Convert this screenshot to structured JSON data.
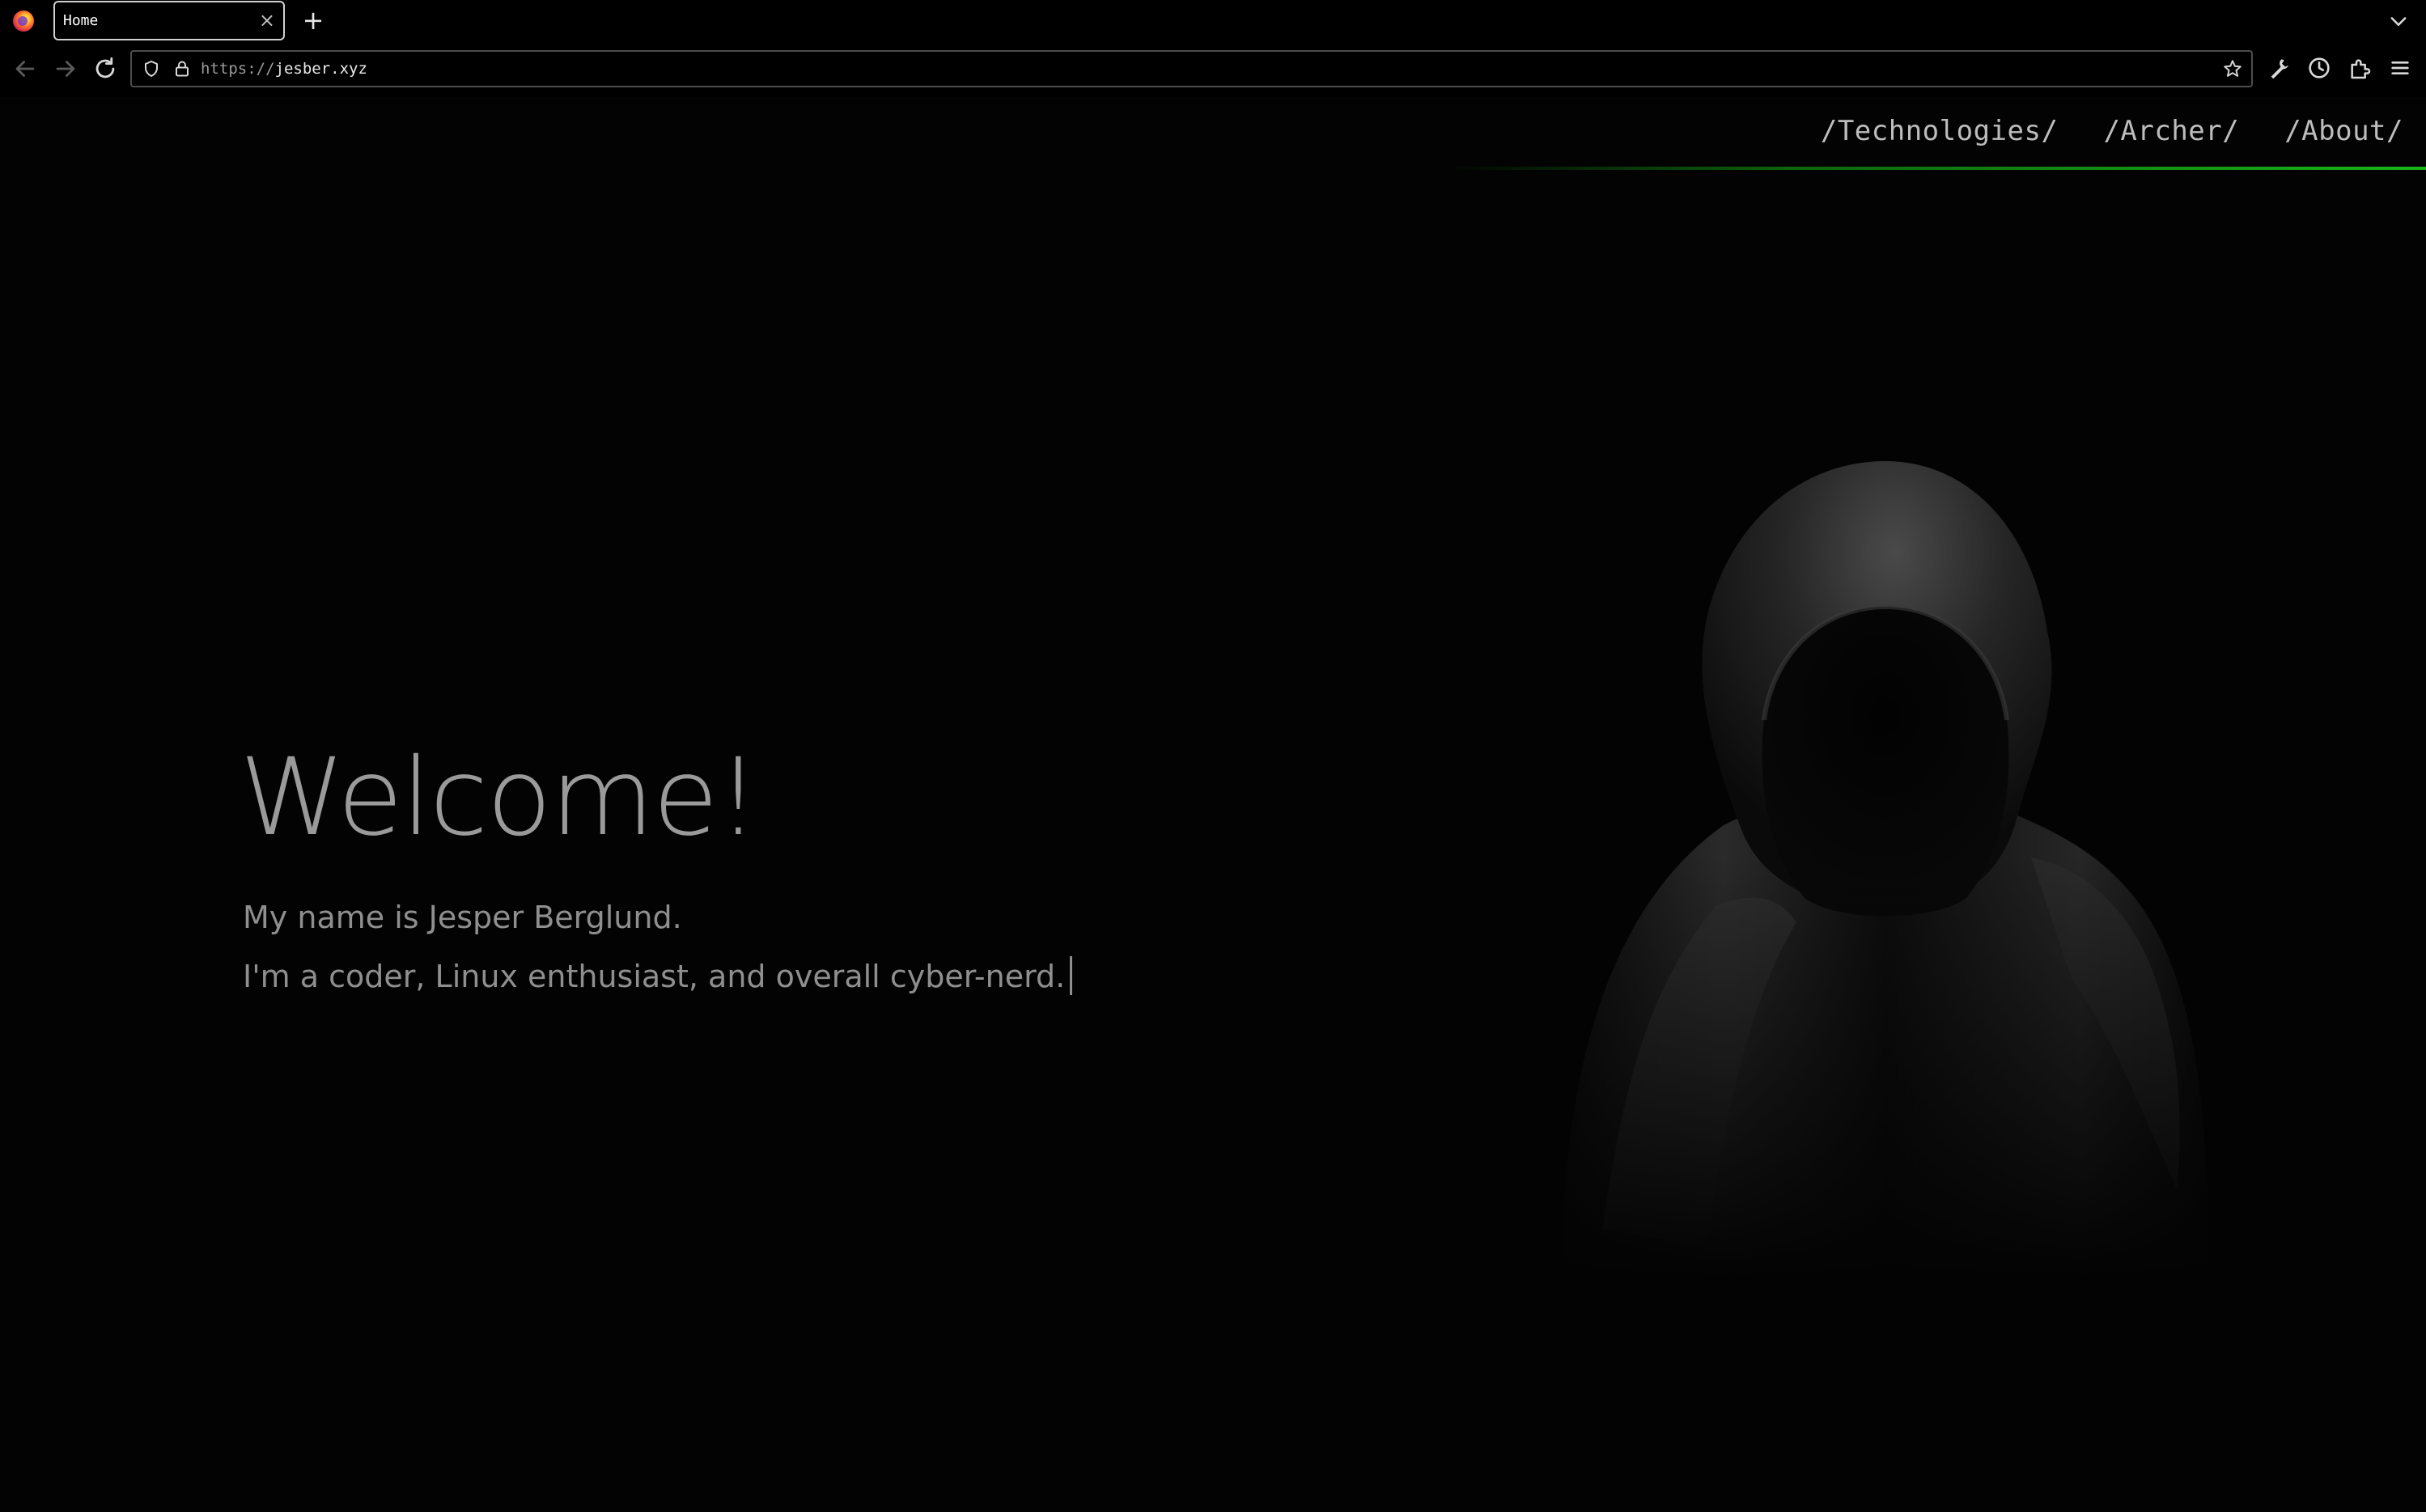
{
  "browser": {
    "tab": {
      "title": "Home",
      "close_label": "×"
    },
    "new_tab_label": "+",
    "url": {
      "protocol": "https://",
      "host": "jesber.xyz"
    }
  },
  "site": {
    "nav": [
      {
        "label": "/Technologies/"
      },
      {
        "label": "/Archer/"
      },
      {
        "label": "/About/"
      }
    ],
    "accent_color": "#19b31a"
  },
  "hero": {
    "heading": "Welcome!",
    "lines": [
      "My name is Jesper Berglund.",
      "I'm a coder, Linux enthusiast, and overall cyber-nerd."
    ],
    "image": "hooded-figure"
  }
}
